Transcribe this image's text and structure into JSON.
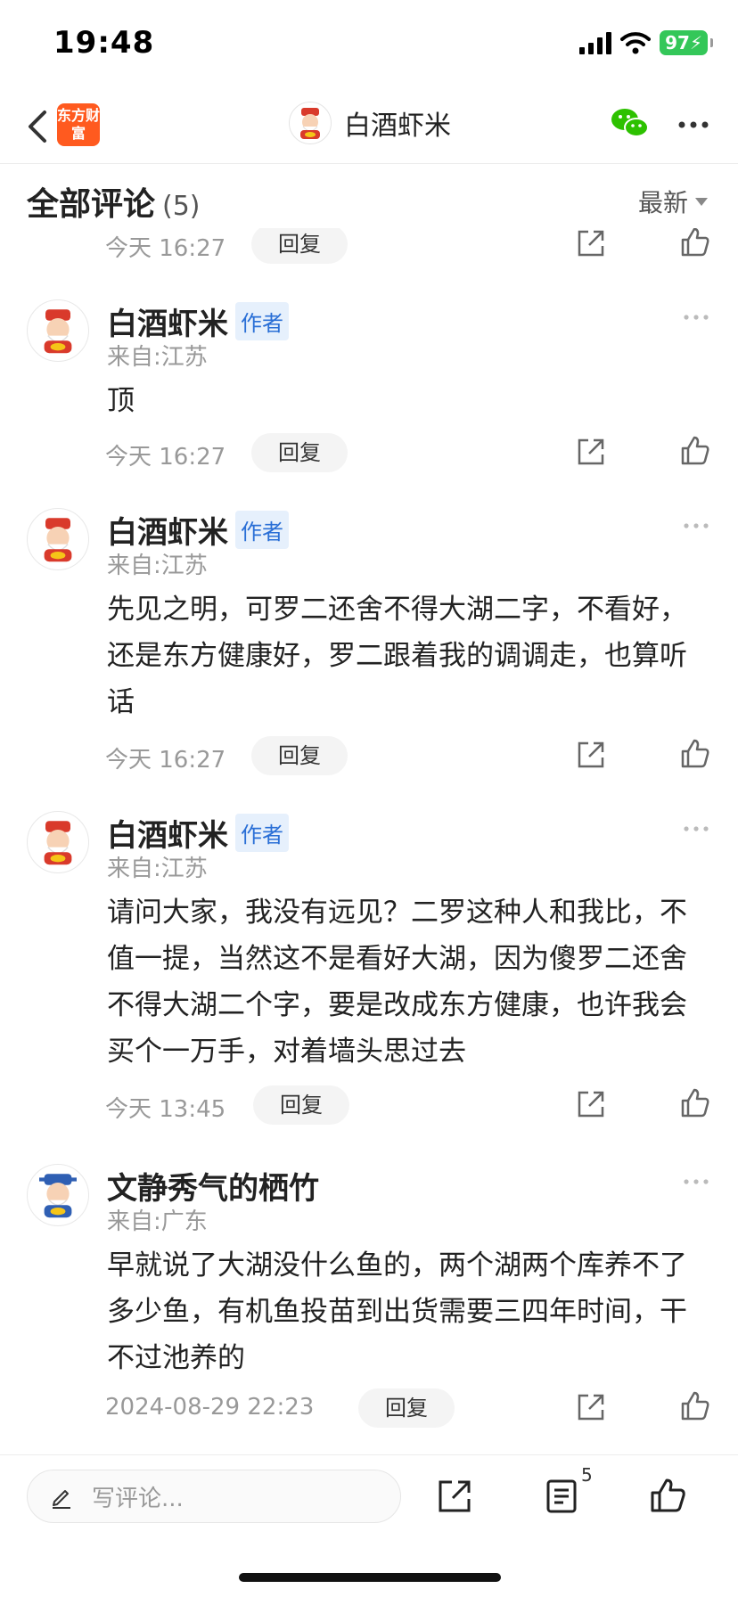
{
  "status_bar": {
    "time": "19:48",
    "battery": "97"
  },
  "nav": {
    "logo_text": "东方财富",
    "title": "白酒虾米"
  },
  "comments_header": {
    "title": "全部评论",
    "count": "(5)",
    "sort": "最新"
  },
  "reply_label": "回复",
  "author_badge": "作者",
  "first_action": {
    "time": "今天 16:27"
  },
  "comments": [
    {
      "name": "白酒虾米",
      "location": "来自:江苏",
      "body": "顶",
      "time": "今天 16:27"
    },
    {
      "name": "白酒虾米",
      "location": "来自:江苏",
      "body": "先见之明，可罗二还舍不得大湖二字，不看好，还是东方健康好，罗二跟着我的调调走，也算听话",
      "time": "今天 16:27"
    },
    {
      "name": "白酒虾米",
      "location": "来自:江苏",
      "body": "请问大家，我没有远见？二罗这种人和我比，不值一提，当然这不是看好大湖，因为傻罗二还舍不得大湖二个字，要是改成东方健康，也许我会买个一万手，对着墙头思过去",
      "time": "今天 13:45"
    },
    {
      "name": "文静秀气的栖竹",
      "location": "来自:广东",
      "body": "早就说了大湖没什么鱼的，两个湖两个库养不了多少鱼，有机鱼投苗到出货需要三四年时间，干不过池养的",
      "time": "2024-08-29 22:23"
    }
  ],
  "bottom_bar": {
    "placeholder": "写评论...",
    "comment_count": "5"
  },
  "colors": {
    "accent_orange": "#ff5a1f",
    "author_badge_text": "#2a6fd6",
    "author_badge_bg": "#e6f0fc",
    "wechat_green": "#2dc100",
    "battery_green": "#34c759"
  }
}
